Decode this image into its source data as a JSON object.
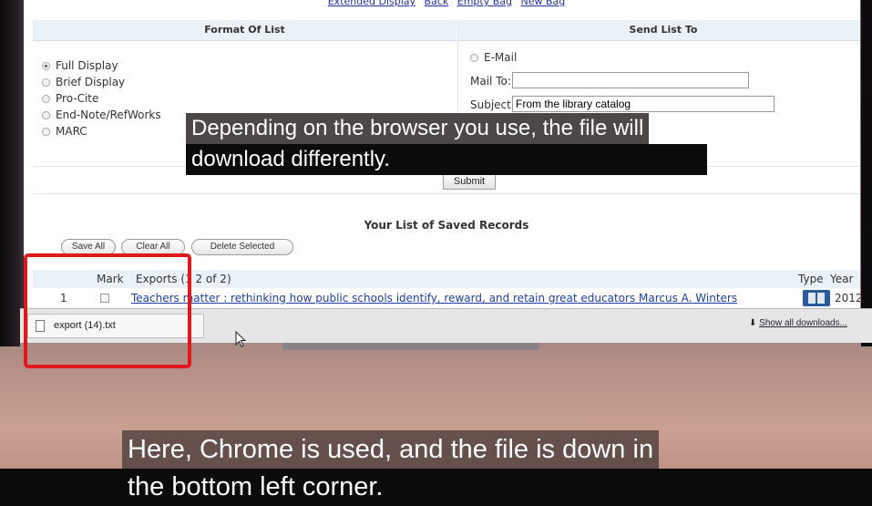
{
  "top_links": [
    "Extended Display",
    "Back",
    "Empty Bag",
    "New Bag"
  ],
  "format_panel": {
    "title": "Format Of List",
    "options": [
      {
        "label": "Full Display",
        "selected": true
      },
      {
        "label": "Brief Display",
        "selected": false
      },
      {
        "label": "Pro-Cite",
        "selected": false
      },
      {
        "label": "End-Note/RefWorks",
        "selected": false
      },
      {
        "label": "MARC",
        "selected": false
      }
    ]
  },
  "send_panel": {
    "title": "Send List To",
    "email_label": "E-Mail",
    "mailto_label": "Mail To:",
    "mailto_value": "",
    "subject_label": "Subject:",
    "subject_value": "From the library catalog"
  },
  "submit_label": "Submit",
  "saved_list": {
    "title": "Your List of Saved Records",
    "buttons": {
      "save_all": "Save All",
      "clear_all": "Clear All",
      "delete_selected": "Delete Selected"
    },
    "header": {
      "mark": "Mark",
      "exports": "Exports (1 2 of 2)",
      "type": "Type",
      "year": "Year"
    },
    "records": [
      {
        "num": "1",
        "title": "Teachers matter : rethinking how public schools identify, reward, and retain great educators Marcus A. Winters",
        "year": "2012"
      }
    ]
  },
  "download_bar": {
    "filename": "export (14).txt",
    "show_all": "Show all downloads..."
  },
  "captions": {
    "top_line1": "Depending on the browser you use, the file will",
    "top_line2": "download differently.",
    "bottom_line1": "Here, Chrome is used, and the file is down in",
    "bottom_line2": "the bottom left corner."
  },
  "colors": {
    "highlight": "#e0171b",
    "link": "#1f3fa6",
    "header_bg": "#eaf1f7"
  }
}
